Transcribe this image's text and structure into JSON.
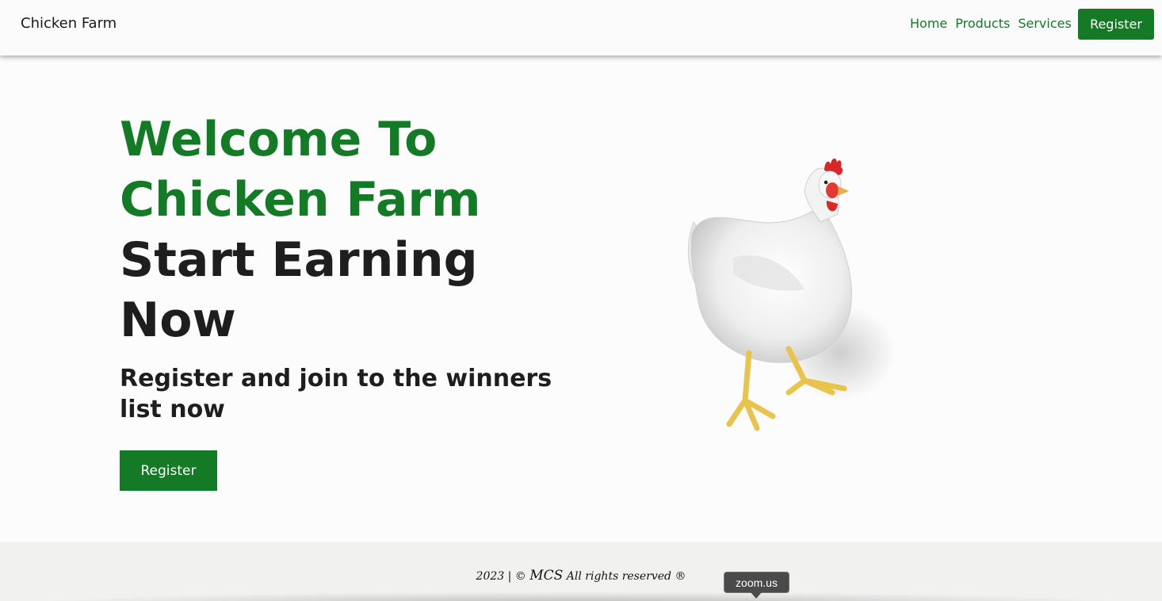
{
  "header": {
    "brand": "Chicken Farm",
    "nav": [
      "Home",
      "Products",
      "Services"
    ],
    "register_label": "Register"
  },
  "hero": {
    "title_green_1": "Welcome To",
    "title_green_2": "Chicken Farm",
    "title_dark_1": "Start Earning",
    "title_dark_2": "Now",
    "subtitle": "Register and join to the winners list now",
    "register_label": "Register",
    "image": "white-chicken"
  },
  "footer": {
    "year": "2023",
    "separator": "| ©",
    "company": "MCS",
    "rights": "All rights reserved ®"
  },
  "tooltip": {
    "text": "zoom.us"
  },
  "colors": {
    "brand_green": "#147a26",
    "dark_text": "#1e1e1e"
  }
}
